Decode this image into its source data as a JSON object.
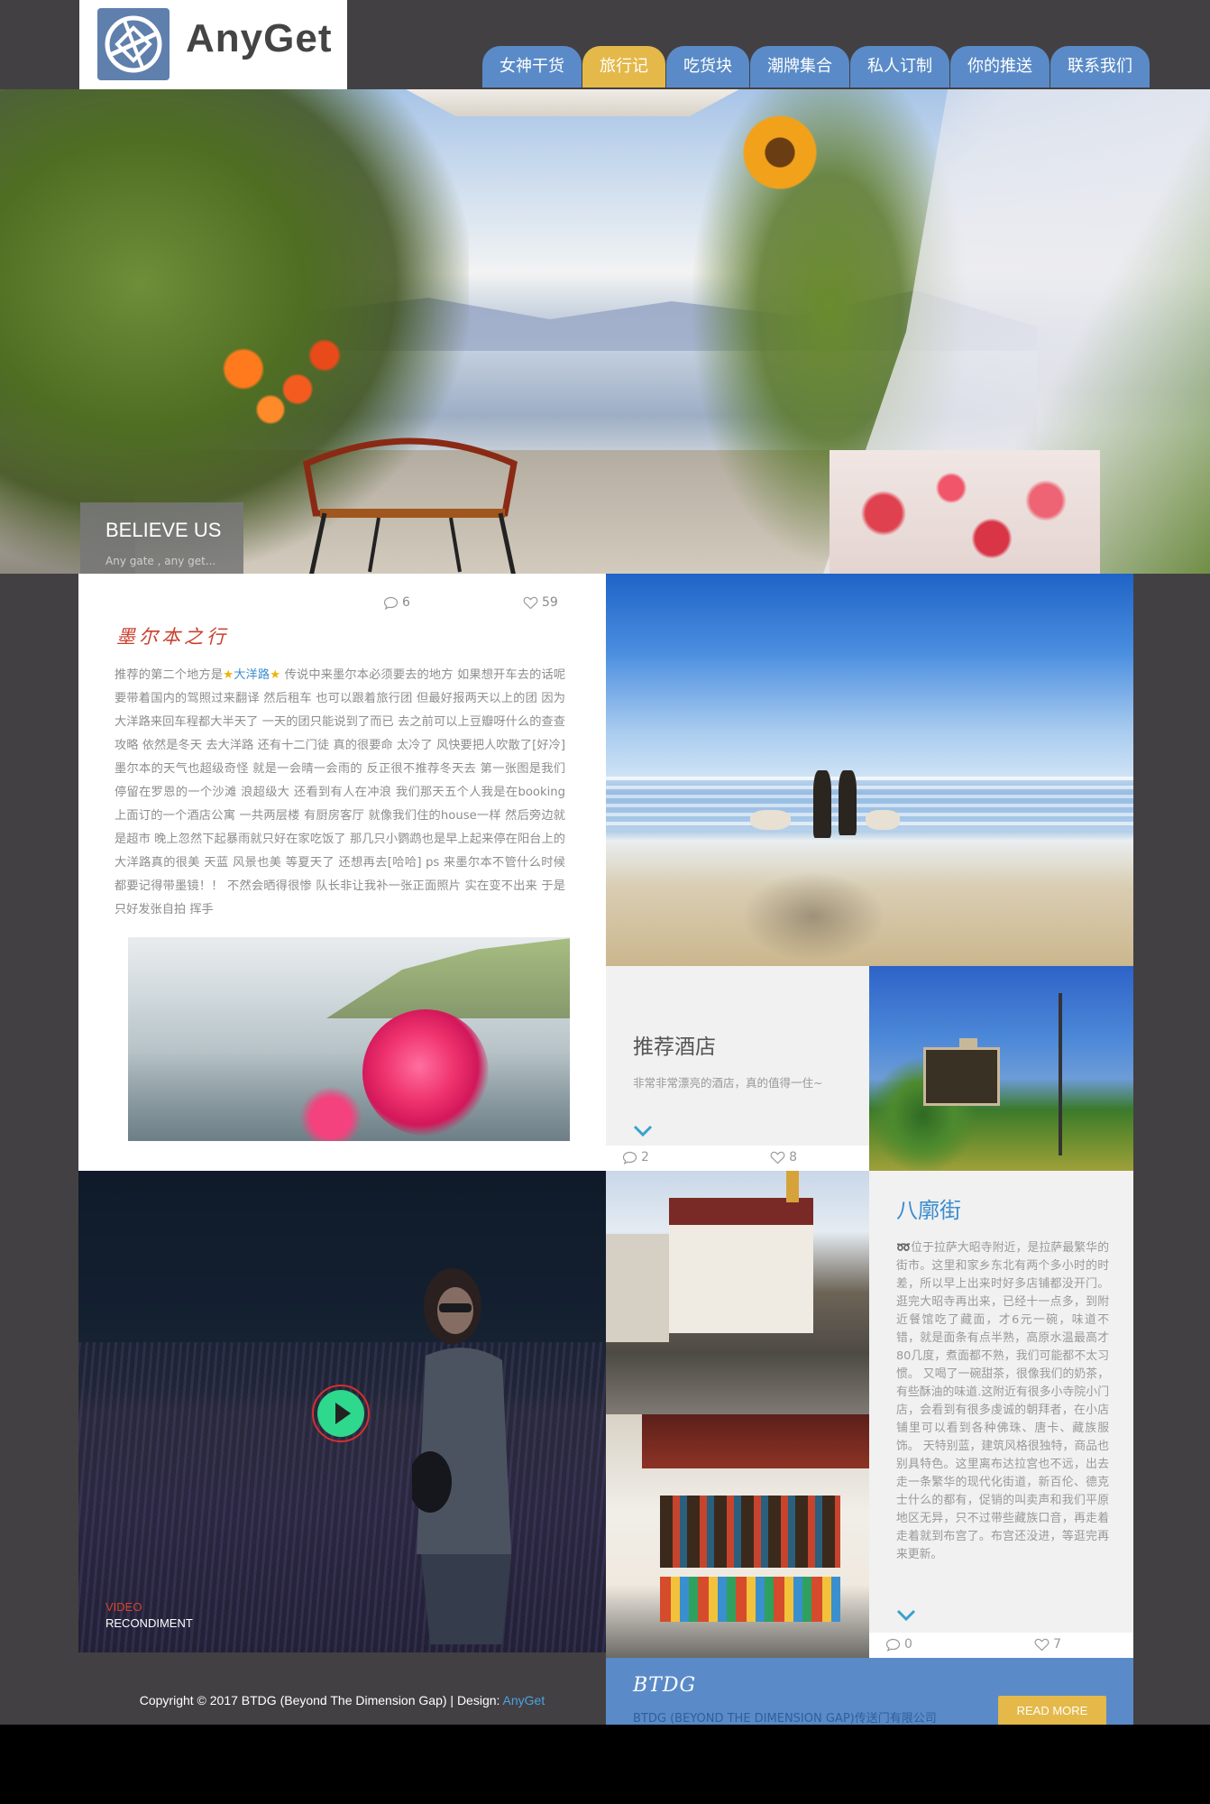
{
  "brand": {
    "name": "AnyGet",
    "logo_icon": "globe-arrow-icon"
  },
  "nav": {
    "items": [
      {
        "label": "女神干货"
      },
      {
        "label": "旅行记",
        "active": true
      },
      {
        "label": "吃货块"
      },
      {
        "label": "潮牌集合"
      },
      {
        "label": "私人订制"
      },
      {
        "label": "你的推送"
      },
      {
        "label": "联系我们"
      }
    ]
  },
  "hero": {
    "title": "BELIEVE US",
    "subtitle": "Any gate , any get..."
  },
  "article": {
    "comments": "6",
    "likes": "59",
    "title": "墨尔本之行",
    "body_before": "推荐的第二个地方是",
    "highlight": "大洋路",
    "body_after": " 传说中来墨尔本必须要去的地方 如果想开车去的话呢 要带着国内的驾照过来翻译 然后租车 也可以跟着旅行团 但最好报两天以上的团 因为大洋路来回车程都大半天了 一天的团只能说到了而已 去之前可以上豆瓣呀什么的查查攻略 依然是冬天 去大洋路 还有十二门徒 真的很要命 太冷了 风快要把人吹散了[好冷] 墨尔本的天气也超级奇怪 就是一会晴一会雨的 反正很不推荐冬天去 第一张图是我们停留在罗恩的一个沙滩 浪超级大 还看到有人在冲浪 我们那天五个人我是在booking上面订的一个酒店公寓 一共两层楼 有厨房客厅 就像我们住的house一样 然后旁边就是超市 晚上忽然下起暴雨就只好在家吃饭了 那几只小鹦鹉也是早上起来停在阳台上的 大洋路真的很美 天蓝 风景也美 等夏天了 还想再去[哈哈] ps 来墨尔本不管什么时候 都要记得带墨镜！！ 不然会晒得很惨 队长非让我补一张正面照片 实在变不出来 于是只好发张自拍 挥手"
  },
  "hotel": {
    "title": "推荐酒店",
    "desc": "非常非常漂亮的酒店，真的值得一住~",
    "comments": "2",
    "likes": "8"
  },
  "video": {
    "tag": "VIDEO",
    "label": "RECONDIMENT"
  },
  "barkhor": {
    "title": "八廓街",
    "body": "➿位于拉萨大昭寺附近，是拉萨最繁华的街市。这里和家乡东北有两个多小时的时差，所以早上出来时好多店铺都没开门。逛完大昭寺再出来，已经十一点多，到附近餐馆吃了藏面，才6元一碗，味道不错，就是面条有点半熟，高原水温最高才80几度，煮面都不熟，我们可能都不太习惯。 又喝了一碗甜茶，很像我们的奶茶，有些酥油的味道.这附近有很多小寺院小门店，会看到有很多虔诚的朝拜者，在小店铺里可以看到各种佛珠、唐卡、藏族服饰。 天特别蓝，建筑风格很独特，商品也别具特色。这里离布达拉宫也不远，出去走一条繁华的现代化街道，新百伦、德克士什么的都有，促销的叫卖声和我们平原地区无异，只不过带些藏族口音，再走着走着就到布宫了。布宫还没进，等逛完再来更新。",
    "comments": "0",
    "likes": "7"
  },
  "footer": {
    "copyright_prefix": "Copyright © 2017 BTDG (Beyond The Dimension Gap) | Design: ",
    "copyright_link": "AnyGet",
    "btdg_title": "BTDG",
    "btdg_sub": "BTDG (BEYOND THE DIMENSION GAP)传送门有限公司",
    "read_more": "READ MORE"
  },
  "colors": {
    "nav_blue": "#5a8bc8",
    "nav_active": "#e4b94a",
    "page_bg": "#434043",
    "accent_text": "#3a8cd0",
    "title_red": "#c9402e",
    "play_green": "#2ed88c"
  }
}
